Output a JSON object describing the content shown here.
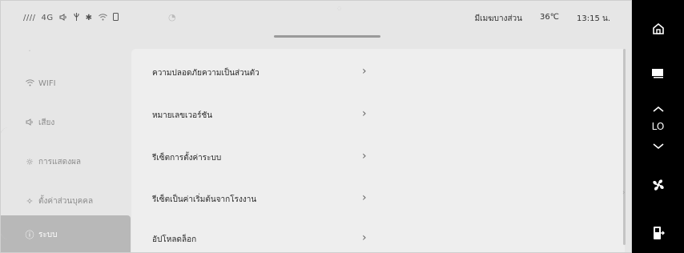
{
  "status_bar": {
    "signal": "////",
    "network": "4G",
    "volume_icon": "speaker-icon",
    "usb_icon": "usb-icon",
    "bluetooth": "✱",
    "wifi_icon": "wifi-icon",
    "phone_icon": "phone-icon",
    "weather": "มีเมฆบางส่วน",
    "temperature": "36℃",
    "time": "13:15 น."
  },
  "sidebar": {
    "items": [
      {
        "label": "WIFI",
        "icon": "wifi-icon"
      },
      {
        "label": "เสียง",
        "icon": "speaker-icon"
      },
      {
        "label": "การแสดงผล",
        "icon": "sun-icon"
      },
      {
        "label": "ตั้งค่าส่วนบุคคล",
        "icon": "personal-settings-icon"
      },
      {
        "label": "ระบบ",
        "icon": "info-icon",
        "active": true
      }
    ]
  },
  "menu": {
    "items": [
      {
        "label": "ความปลอดภัยความเป็นส่วนตัว"
      },
      {
        "label": "หมายเลขเวอร์ชัน"
      },
      {
        "label": "รีเซ็ตการตั้งค่าระบบ"
      },
      {
        "label": "รีเซ็ตเป็นค่าเริ่มต้นจากโรงงาน"
      },
      {
        "label": "อัปโหลดล็อก"
      }
    ]
  },
  "dock": {
    "fan_level": "LO",
    "colors": {
      "background": "#000000",
      "icon": "#ffffff"
    }
  }
}
